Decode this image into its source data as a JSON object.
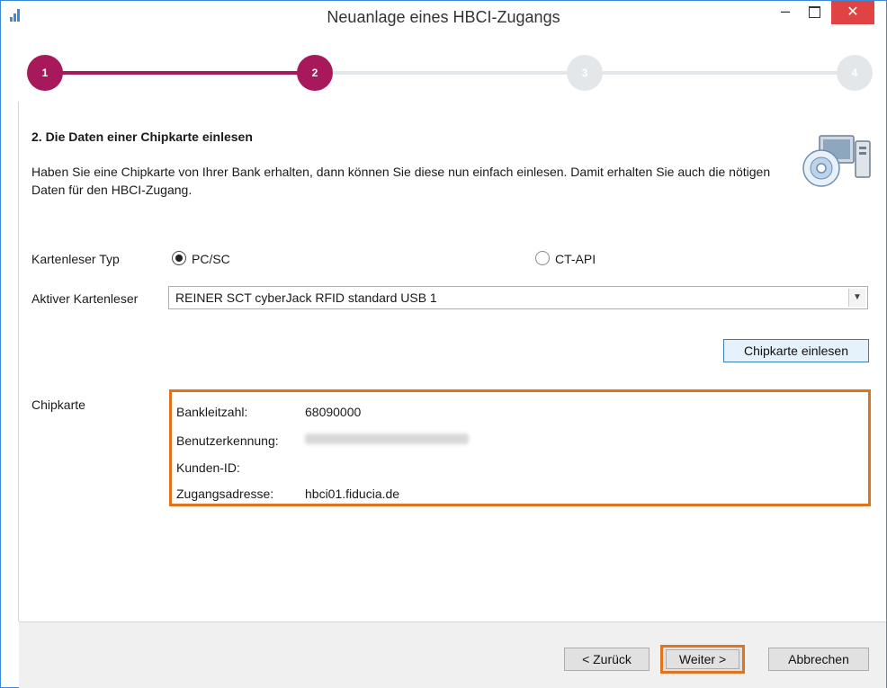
{
  "window": {
    "title": "Neuanlage eines HBCI-Zugangs",
    "close_label": "✕",
    "minimize_label": "–"
  },
  "steps": [
    {
      "number": "1",
      "state": "active"
    },
    {
      "number": "2",
      "state": "active"
    },
    {
      "number": "3",
      "state": "inactive"
    },
    {
      "number": "4",
      "state": "inactive"
    }
  ],
  "content": {
    "heading": "2. Die Daten einer Chipkarte einlesen",
    "description": "Haben Sie eine Chipkarte von Ihrer Bank erhalten, dann können Sie diese nun einfach einlesen. Damit erhalten Sie auch die nötigen Daten für den HBCI-Zugang."
  },
  "reader_type": {
    "label": "Kartenleser Typ",
    "options": [
      {
        "label": "PC/SC",
        "selected": true
      },
      {
        "label": "CT-API",
        "selected": false
      }
    ]
  },
  "active_reader": {
    "label": "Aktiver Kartenleser",
    "value": "REINER SCT cyberJack RFID standard USB 1"
  },
  "read_button": "Chipkarte einlesen",
  "chipcard": {
    "label": "Chipkarte",
    "rows": [
      {
        "label": "Bankleitzahl:",
        "value": "68090000"
      },
      {
        "label": "Benutzerkennung:",
        "value": ""
      },
      {
        "label": "Kunden-ID:",
        "value": ""
      },
      {
        "label": "Zugangsadresse:",
        "value": "hbci01.fiducia.de"
      }
    ]
  },
  "footer": {
    "back": "< Zurück",
    "next": "Weiter >",
    "cancel": "Abbrechen"
  },
  "colors": {
    "accent": "#a8195c",
    "highlight": "#e0731e",
    "inactive_step": "#e3e7ea",
    "window_border": "#3c8ad6",
    "close_button": "#e04343"
  },
  "icons": {
    "app": "signal-bars-icon",
    "card_reader": "computer-disc-icon",
    "dropdown": "chevron-down-icon"
  }
}
